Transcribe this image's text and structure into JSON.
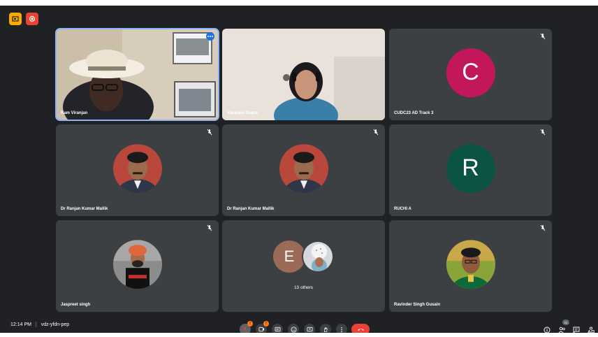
{
  "meeting": {
    "time": "12:14 PM",
    "separator": "|",
    "code": "vdz-yfdn-pep"
  },
  "participants": [
    {
      "name": "Ram Viranjan"
    },
    {
      "name": "Vandana Gupta"
    },
    {
      "name": "CUDC23 AD Track 3",
      "initial": "C"
    },
    {
      "name": "Dr Ranjan Kumar Mallik"
    },
    {
      "name": "Dr Ranjan Kumar Mallik"
    },
    {
      "name": "RUCHI A",
      "initial": "R"
    },
    {
      "name": "Jaspreet singh"
    },
    {
      "others_label": "13 others",
      "initial": "E"
    },
    {
      "name": "Ravinder Singh Gusain"
    }
  ],
  "controls": {
    "mic_badge": "!",
    "cam_badge": "!",
    "people_count": "21"
  },
  "colors": {
    "background": "#202124",
    "tile": "#3c4043",
    "accent": "#8ab4f8",
    "hangup": "#ea4335",
    "avatar_c": "#c2185b",
    "avatar_r": "#0b5345",
    "avatar_e": "#9c6b57"
  },
  "icons": [
    "present-icon",
    "record-icon",
    "mic-off-icon",
    "camera-off-icon",
    "captions-icon",
    "emoji-icon",
    "present-screen-icon",
    "raise-hand-icon",
    "more-options-icon",
    "hang-up-icon",
    "info-icon",
    "people-icon",
    "chat-icon",
    "activities-icon"
  ]
}
